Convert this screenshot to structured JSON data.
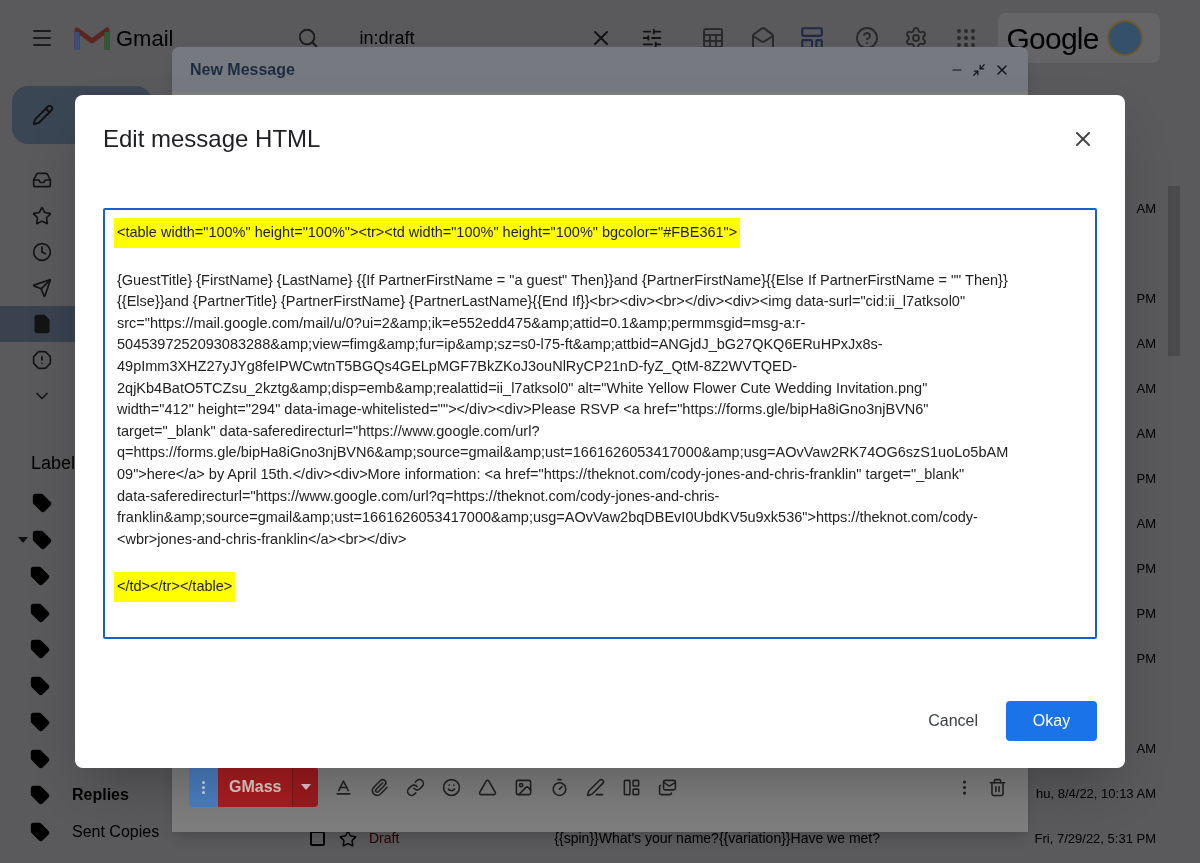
{
  "header": {
    "app_name": "Gmail",
    "search": {
      "value": "in:draft"
    },
    "brand": "Google"
  },
  "sidebar": {
    "nav": [
      {
        "kind": "inbox",
        "selected": false
      },
      {
        "kind": "starred",
        "selected": false
      },
      {
        "kind": "snoozed",
        "selected": false
      },
      {
        "kind": "sent",
        "selected": false
      },
      {
        "kind": "drafts",
        "selected": true
      },
      {
        "kind": "spam",
        "selected": false
      },
      {
        "kind": "more",
        "selected": false
      }
    ],
    "labels_heading": "Label",
    "labels": [
      {
        "kind": "label",
        "expanded": false
      },
      {
        "kind": "label",
        "expanded": true,
        "children": [
          {
            "kind": "label"
          },
          {
            "kind": "label"
          },
          {
            "kind": "label"
          },
          {
            "kind": "label"
          },
          {
            "kind": "label"
          },
          {
            "kind": "label"
          },
          {
            "kind": "label",
            "name": "Replies",
            "unread": true
          },
          {
            "kind": "label",
            "name": "Sent Copies",
            "unread": false
          }
        ]
      }
    ]
  },
  "mail_list": {
    "rows": [
      {
        "kind": "partial",
        "time": "AM"
      },
      {
        "kind": "blank"
      },
      {
        "kind": "partial",
        "time": "PM"
      },
      {
        "kind": "partial",
        "time": "AM"
      },
      {
        "kind": "partial",
        "time": "AM"
      },
      {
        "kind": "partial",
        "time": "AM"
      },
      {
        "kind": "partial",
        "time": "PM"
      },
      {
        "kind": "partial",
        "time": "AM"
      },
      {
        "kind": "partial",
        "time": "PM"
      },
      {
        "kind": "partial",
        "time": "PM"
      },
      {
        "kind": "partial",
        "time": "PM"
      },
      {
        "kind": "blank"
      },
      {
        "kind": "partial",
        "time": "AM"
      },
      {
        "kind": "partial",
        "time": "hu, 8/4/22, 10:13 AM"
      },
      {
        "kind": "draft",
        "checked": false,
        "status": "Draft",
        "subject": "{{spin}}What's your name?{{variation}}Have we met?",
        "time": "Fri, 7/29/22, 5:31 PM"
      }
    ]
  },
  "compose": {
    "title": "New Message",
    "send_button": "GMass"
  },
  "dialog": {
    "title": "Edit message HTML",
    "html_blocks": [
      {
        "highlighted": true,
        "lines": [
          "<table width=\"100%\" height=\"100%\"><tr><td width=\"100%\" height=\"100%\" bgcolor=\"#FBE361\">"
        ]
      },
      {
        "highlighted": false,
        "lines": [
          "{GuestTitle} {FirstName} {LastName} {{If PartnerFirstName = \"a guest\" Then}}and {PartnerFirstName}{{Else If PartnerFirstName = \"\" Then}}",
          "{{Else}}and {PartnerTitle} {PartnerFirstName} {PartnerLastName}{{End If}}<br><div><br></div><div><img data-surl=\"cid:ii_l7atksol0\"",
          "src=\"https://mail.google.com/mail/u/0?ui=2&amp;ik=e552edd475&amp;attid=0.1&amp;permmsgid=msg-a:r-",
          "5045397252093083288&amp;view=fimg&amp;fur=ip&amp;sz=s0-l75-ft&amp;attbid=ANGjdJ_bG27QKQ6ERuHPxJx8s-",
          "49pImm3XHZ27yJYg8feIPWCwtnT5BGQs4GELpMGF7BkZKoJ3ouNlRyCP21nD-fyZ_QtM-8Z2WVTQED-",
          "2qjKb4BatO5TCZsu_2kztg&amp;disp=emb&amp;realattid=ii_l7atksol0\" alt=\"White Yellow Flower Cute Wedding Invitation.png\"",
          "width=\"412\" height=\"294\" data-image-whitelisted=\"\"></div><div>Please RSVP <a href=\"https://forms.gle/bipHa8iGno3njBVN6\"",
          "target=\"_blank\" data-saferedirecturl=\"https://www.google.com/url?",
          "q=https://forms.gle/bipHa8iGno3njBVN6&amp;source=gmail&amp;ust=1661626053417000&amp;usg=AOvVaw2RK74OG6szS1uoLo5bAM",
          "09\">here</a> by April 15th.</div><div>More information: <a href=\"https://theknot.com/cody-jones-and-chris-franklin\" target=\"_blank\"",
          "data-saferedirecturl=\"https://www.google.com/url?q=https://theknot.com/cody-jones-and-chris-",
          "franklin&amp;source=gmail&amp;ust=1661626053417000&amp;usg=AOvVaw2bqDBEvI0UbdKV5u9xk536\">https://theknot.com/cody-",
          "<wbr>jones-and-chris-franklin</a><br></div>"
        ]
      },
      {
        "highlighted": true,
        "lines": [
          "</td></tr></table>"
        ]
      }
    ],
    "buttons": {
      "cancel": "Cancel",
      "ok": "Okay"
    }
  }
}
